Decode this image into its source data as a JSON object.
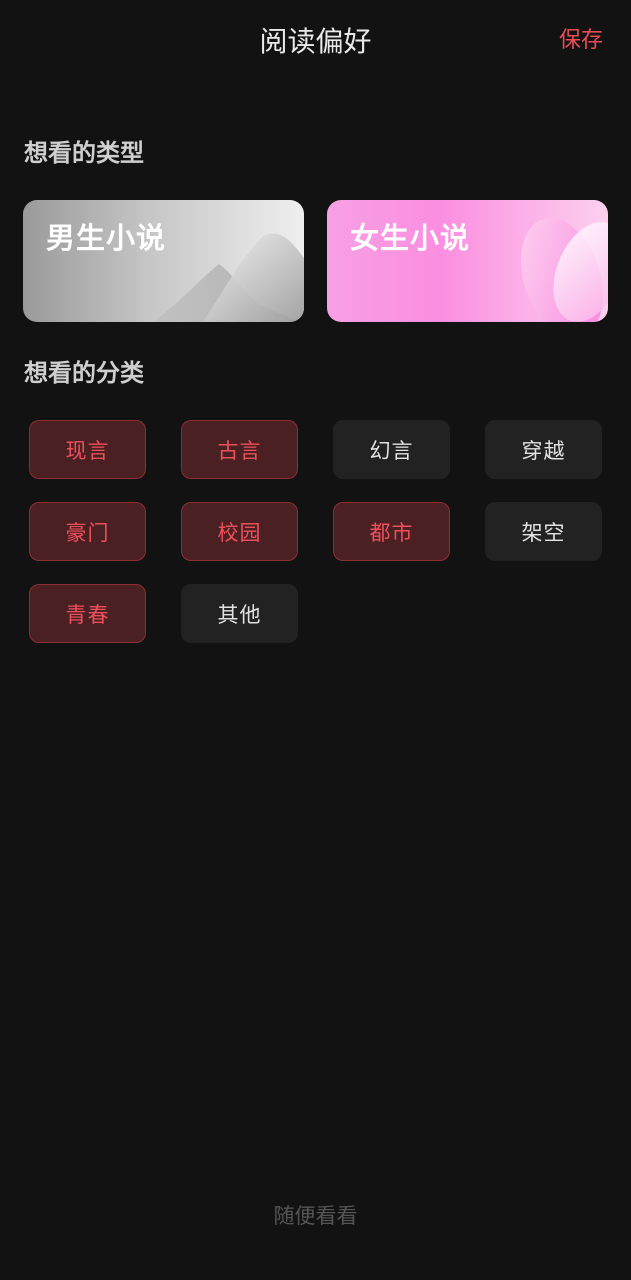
{
  "header": {
    "title": "阅读偏好",
    "save_label": "保存"
  },
  "type_section": {
    "title": "想看的类型",
    "cards": [
      {
        "label": "男生小说"
      },
      {
        "label": "女生小说"
      }
    ]
  },
  "category_section": {
    "title": "想看的分类",
    "tags": [
      {
        "label": "现言",
        "selected": true
      },
      {
        "label": "古言",
        "selected": true
      },
      {
        "label": "幻言",
        "selected": false
      },
      {
        "label": "穿越",
        "selected": false
      },
      {
        "label": "豪门",
        "selected": true
      },
      {
        "label": "校园",
        "selected": true
      },
      {
        "label": "都市",
        "selected": true
      },
      {
        "label": "架空",
        "selected": false
      },
      {
        "label": "青春",
        "selected": true
      },
      {
        "label": "其他",
        "selected": false
      }
    ]
  },
  "footer": {
    "random_label": "随便看看"
  },
  "colors": {
    "background": "#121212",
    "accent": "#ec4b57",
    "selected_bg": "#4a2022",
    "selected_border": "#8a2f34",
    "unselected_bg": "#222222"
  }
}
